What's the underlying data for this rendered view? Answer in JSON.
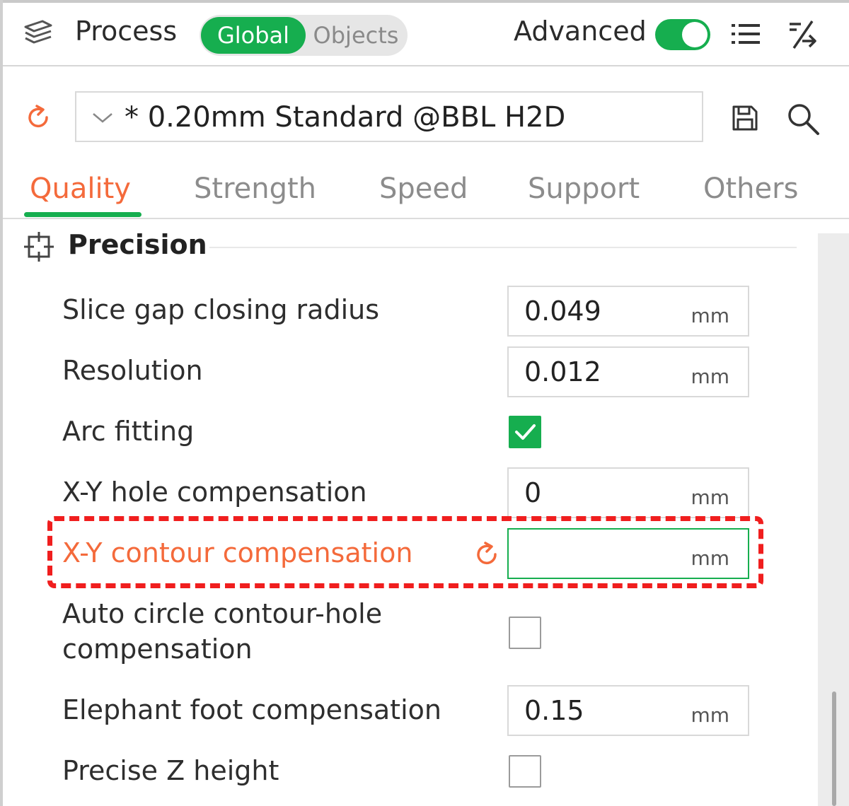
{
  "header": {
    "title": "Process",
    "mode_global": "Global",
    "mode_objects": "Objects",
    "advanced_label": "Advanced",
    "advanced_on": true,
    "icons": [
      "layers-icon",
      "list-icon",
      "compare-icon"
    ]
  },
  "preset": {
    "name": "* 0.20mm Standard @BBL H2D",
    "icons": [
      "reset-icon",
      "chevron-down-icon",
      "save-icon",
      "search-icon"
    ]
  },
  "tabs": [
    {
      "label": "Quality",
      "active": true
    },
    {
      "label": "Strength",
      "active": false
    },
    {
      "label": "Speed",
      "active": false
    },
    {
      "label": "Support",
      "active": false
    },
    {
      "label": "Others",
      "active": false
    }
  ],
  "section": {
    "title": "Precision",
    "icon": "precision-icon"
  },
  "settings": {
    "slice_gap": {
      "label": "Slice gap closing radius",
      "value": "0.049",
      "unit": "mm"
    },
    "resolution": {
      "label": "Resolution",
      "value": "0.012",
      "unit": "mm"
    },
    "arc_fitting": {
      "label": "Arc fitting",
      "checked": true
    },
    "xy_hole": {
      "label": "X-Y hole compensation",
      "value": "0",
      "unit": "mm"
    },
    "xy_contour": {
      "label": "X-Y contour compensation",
      "value": "",
      "unit": "mm",
      "modified": true
    },
    "auto_circle": {
      "label_line1": "Auto circle contour-hole",
      "label_line2": "compensation",
      "checked": false
    },
    "elephant_foot": {
      "label": "Elephant foot compensation",
      "value": "0.15",
      "unit": "mm"
    },
    "precise_z": {
      "label": "Precise Z height",
      "checked": false
    }
  },
  "colors": {
    "accent_green": "#16ae4f",
    "modified_orange": "#f46a3b",
    "highlight_red": "#f01e1e"
  }
}
